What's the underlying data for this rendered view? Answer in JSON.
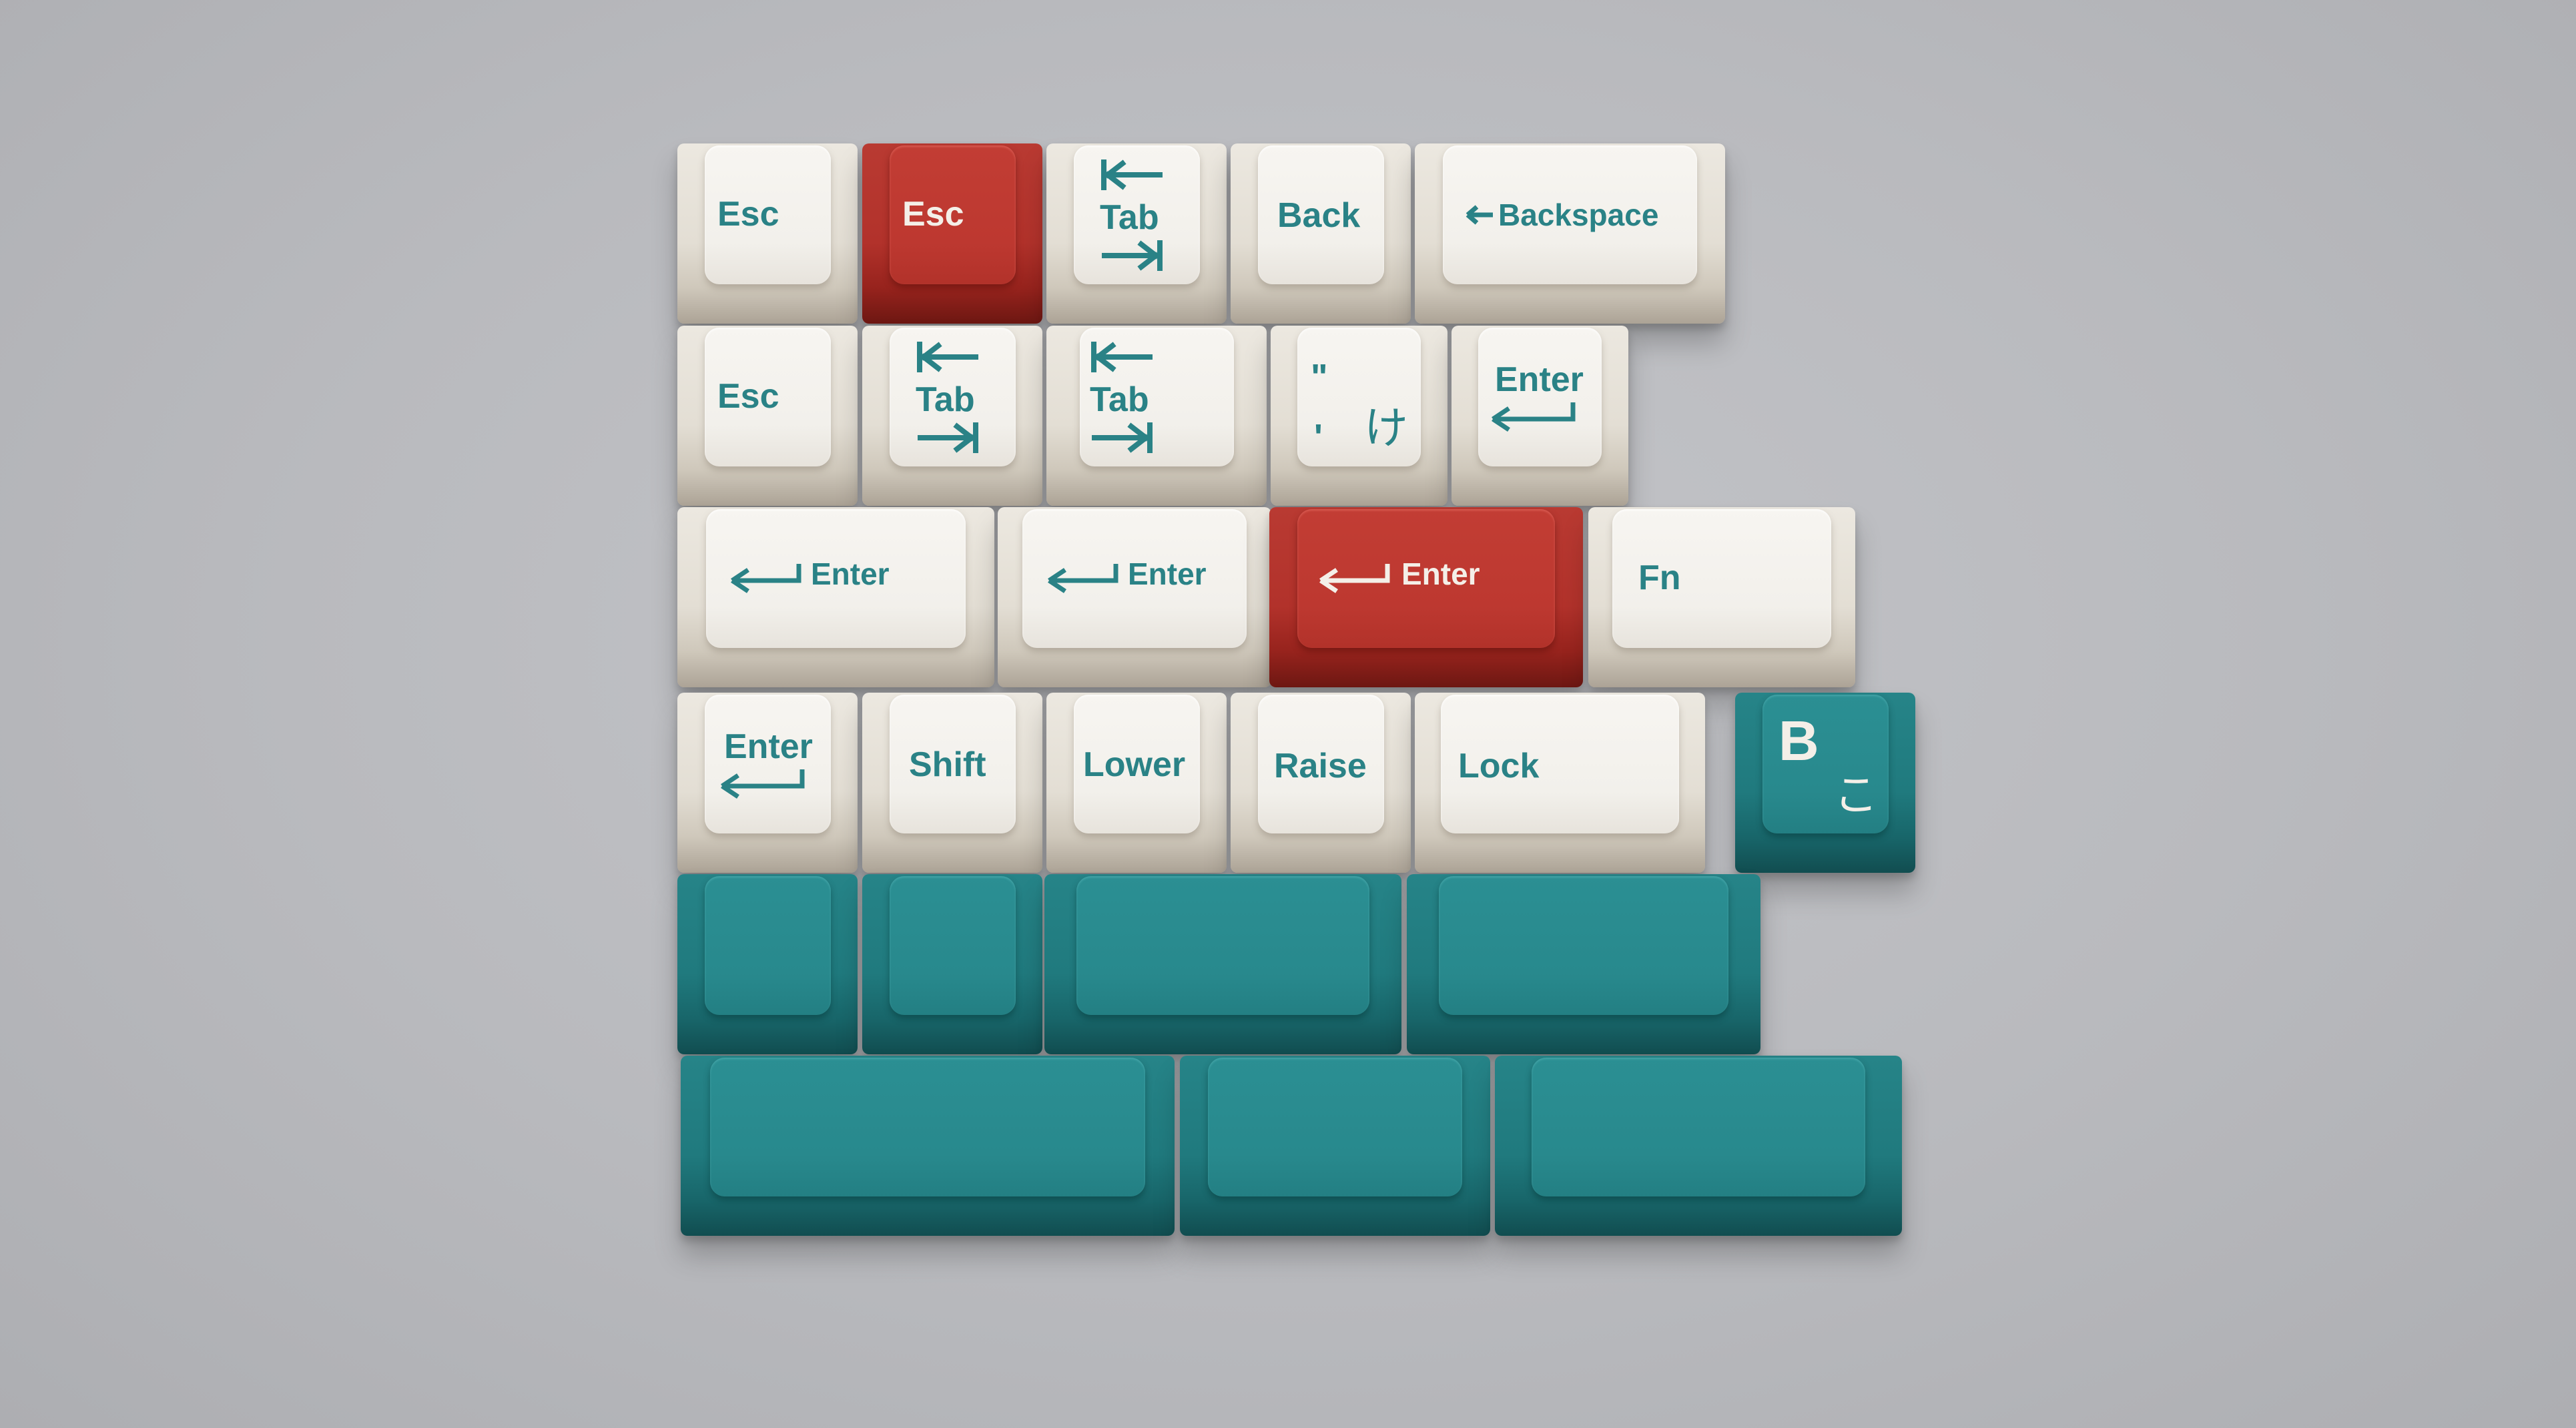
{
  "colors": {
    "background": "#b9babe",
    "white_cap": "#f2f0eb",
    "red_cap": "#bd3830",
    "teal_cap": "#28898d",
    "legend_teal": "#2a8286",
    "legend_light": "#f4efe8"
  },
  "keys": {
    "row1": {
      "esc_white": "Esc",
      "esc_red": "Esc",
      "tab": "Tab",
      "back": "Back",
      "backspace": "Backspace"
    },
    "row2": {
      "esc_white": "Esc",
      "tab_a": "Tab",
      "tab_b": "Tab",
      "quote_top": "\"",
      "quote_bottom": "'",
      "kana_ke": "け",
      "enter": "Enter"
    },
    "row3": {
      "enter_a": "Enter",
      "enter_b": "Enter",
      "enter_red": "Enter",
      "fn": "Fn"
    },
    "row4": {
      "enter": "Enter",
      "shift": "Shift",
      "lower": "Lower",
      "raise": "Raise",
      "lock": "Lock",
      "b_key": "B",
      "kana_ko": "こ"
    }
  },
  "icons": {
    "tab_left": "arrow-left-bar-icon",
    "tab_right": "arrow-right-bar-icon",
    "enter": "return-arrow-icon",
    "backspace": "left-arrow-icon"
  }
}
